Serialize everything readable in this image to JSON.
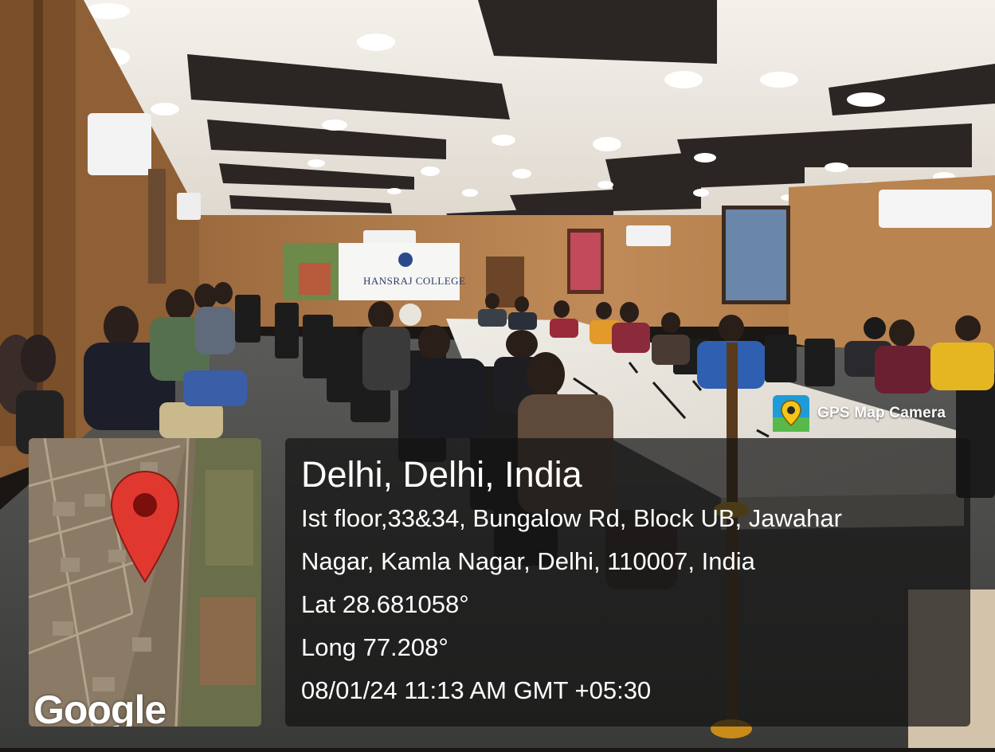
{
  "app": {
    "name": "GPS Map Camera",
    "icon": "map-pin-camera-icon"
  },
  "banner": {
    "college_name": "HANSRAJ COLLEGE"
  },
  "map": {
    "provider_logo": "Google",
    "marker_icon": "location-pin-icon"
  },
  "location": {
    "title": "Delhi, Delhi, India",
    "address_line1": "Ist floor,33&34, Bungalow Rd, Block UB, Jawahar",
    "address_line2": "Nagar, Kamla Nagar, Delhi, 110007, India",
    "latitude": "Lat 28.681058°",
    "longitude": "Long 77.208°",
    "timestamp": "08/01/24 11:13 AM GMT +05:30"
  },
  "colors": {
    "overlay_bg": "#141414",
    "marker_red": "#e0382f",
    "wood_wall": "#b07a4a"
  }
}
